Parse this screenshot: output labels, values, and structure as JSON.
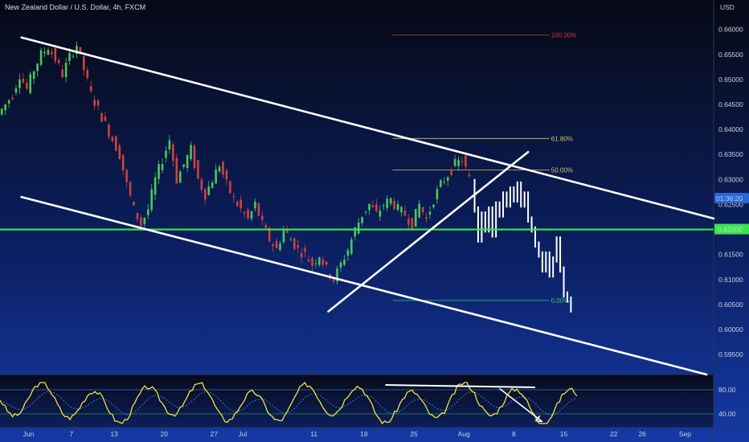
{
  "chart_data": {
    "type": "candlestick",
    "title": "New Zealand Dollar / U.S. Dollar, 4h, FXCM",
    "currency": "USD",
    "y_ticks": [
      "0.66000",
      "0.65500",
      "0.65000",
      "0.64500",
      "0.64000",
      "0.63500",
      "0.63000",
      "0.62500",
      "0.62000",
      "0.61500",
      "0.61000",
      "0.60500",
      "0.60000",
      "0.59500"
    ],
    "y_tick_values": [
      0.66,
      0.655,
      0.65,
      0.645,
      0.64,
      0.635,
      0.63,
      0.625,
      0.62,
      0.615,
      0.61,
      0.605,
      0.6,
      0.595
    ],
    "ylim": [
      0.591,
      0.663
    ],
    "x_ticks": [
      "Jun",
      "7",
      "13",
      "20",
      "27",
      "Jul",
      "11",
      "18",
      "25",
      "Aug",
      "8",
      "15",
      "22",
      "26",
      "Sep"
    ],
    "x_tick_day": [
      0,
      6,
      12,
      19,
      26,
      30,
      40,
      47,
      54,
      61,
      68,
      75,
      82,
      86,
      92
    ],
    "xlim": [
      -4,
      96
    ],
    "current_price_label": "0.62000",
    "timer_label": "01:36:20",
    "timer_price": 0.6262,
    "horizontal_level": 0.62,
    "fib_levels": [
      {
        "label": "100.00%",
        "price": 0.6589,
        "color": "#c63b3b",
        "day_start": 51,
        "day_end": 73
      },
      {
        "label": "61.80%",
        "price": 0.6382,
        "color": "#d9c06a",
        "day_start": 51,
        "day_end": 73
      },
      {
        "label": "50.00%",
        "price": 0.6319,
        "color": "#d9c06a",
        "day_start": 51,
        "day_end": 73
      },
      {
        "label": "0.00%",
        "price": 0.6058,
        "color": "#39c76a",
        "day_start": 51,
        "day_end": 73
      }
    ],
    "candles_path": [
      [
        -4,
        0.643
      ],
      [
        -2,
        0.647
      ],
      [
        -1,
        0.651
      ],
      [
        0,
        0.648
      ],
      [
        1,
        0.652
      ],
      [
        2,
        0.655
      ],
      [
        3,
        0.6565
      ],
      [
        4,
        0.654
      ],
      [
        5,
        0.651
      ],
      [
        6,
        0.6545
      ],
      [
        7,
        0.657
      ],
      [
        8,
        0.652
      ],
      [
        9,
        0.647
      ],
      [
        10,
        0.644
      ],
      [
        11,
        0.641
      ],
      [
        12,
        0.638
      ],
      [
        13,
        0.635
      ],
      [
        14,
        0.629
      ],
      [
        15,
        0.624
      ],
      [
        16,
        0.621
      ],
      [
        17,
        0.624
      ],
      [
        18,
        0.63
      ],
      [
        19,
        0.634
      ],
      [
        20,
        0.638
      ],
      [
        21,
        0.63
      ],
      [
        22,
        0.633
      ],
      [
        23,
        0.636
      ],
      [
        24,
        0.63
      ],
      [
        25,
        0.627
      ],
      [
        26,
        0.63
      ],
      [
        27,
        0.633
      ],
      [
        28,
        0.629
      ],
      [
        29,
        0.626
      ],
      [
        30,
        0.624
      ],
      [
        31,
        0.622
      ],
      [
        32,
        0.625
      ],
      [
        33,
        0.621
      ],
      [
        34,
        0.618
      ],
      [
        35,
        0.616
      ],
      [
        36,
        0.62
      ],
      [
        37,
        0.618
      ],
      [
        38,
        0.616
      ],
      [
        39,
        0.615
      ],
      [
        40,
        0.613
      ],
      [
        41,
        0.615
      ],
      [
        42,
        0.612
      ],
      [
        43,
        0.61
      ],
      [
        44,
        0.613
      ],
      [
        45,
        0.616
      ],
      [
        46,
        0.62
      ],
      [
        47,
        0.623
      ],
      [
        48,
        0.625
      ],
      [
        49,
        0.623
      ],
      [
        50,
        0.625
      ],
      [
        51,
        0.626
      ],
      [
        52,
        0.624
      ],
      [
        53,
        0.623
      ],
      [
        54,
        0.621
      ],
      [
        55,
        0.625
      ],
      [
        56,
        0.622
      ],
      [
        57,
        0.626
      ],
      [
        58,
        0.629
      ],
      [
        59,
        0.631
      ],
      [
        60,
        0.633
      ],
      [
        61,
        0.634
      ],
      [
        62,
        0.63
      ]
    ],
    "projection_path": [
      [
        62.5,
        0.6295
      ],
      [
        63,
        0.624
      ],
      [
        63.5,
        0.618
      ],
      [
        64,
        0.623
      ],
      [
        64.5,
        0.62
      ],
      [
        65,
        0.624
      ],
      [
        65.5,
        0.619
      ],
      [
        66,
        0.625
      ],
      [
        66.5,
        0.623
      ],
      [
        67,
        0.627
      ],
      [
        67.5,
        0.625
      ],
      [
        68,
        0.628
      ],
      [
        68.5,
        0.626
      ],
      [
        69,
        0.629
      ],
      [
        69.5,
        0.625
      ],
      [
        70,
        0.627
      ],
      [
        70.5,
        0.622
      ],
      [
        71,
        0.62
      ],
      [
        71.5,
        0.617
      ],
      [
        72,
        0.615
      ],
      [
        72.5,
        0.612
      ],
      [
        73,
        0.615
      ],
      [
        73.5,
        0.611
      ],
      [
        74,
        0.614
      ],
      [
        74.5,
        0.618
      ],
      [
        75,
        0.612
      ],
      [
        75.5,
        0.607
      ],
      [
        76,
        0.606
      ],
      [
        76.3,
        0.604
      ]
    ],
    "trendlines": [
      {
        "name": "channel-upper",
        "p1": [
          -1,
          0.6584
        ],
        "p2": [
          96,
          0.6222
        ]
      },
      {
        "name": "channel-lower",
        "p1": [
          -1,
          0.6265
        ],
        "p2": [
          95,
          0.591
        ]
      },
      {
        "name": "rising-support",
        "p1": [
          42,
          0.6036
        ],
        "p2": [
          70,
          0.6355
        ]
      }
    ],
    "oscillator": {
      "levels": [
        "80.00",
        "40.00"
      ],
      "level_values": [
        80,
        40
      ],
      "ylim": [
        20,
        100
      ],
      "divergence_line": {
        "p1": [
          50,
          88
        ],
        "p2": [
          71,
          84
        ]
      },
      "arrow": {
        "p1": [
          66,
          82
        ],
        "p2": [
          72,
          27
        ]
      }
    }
  }
}
